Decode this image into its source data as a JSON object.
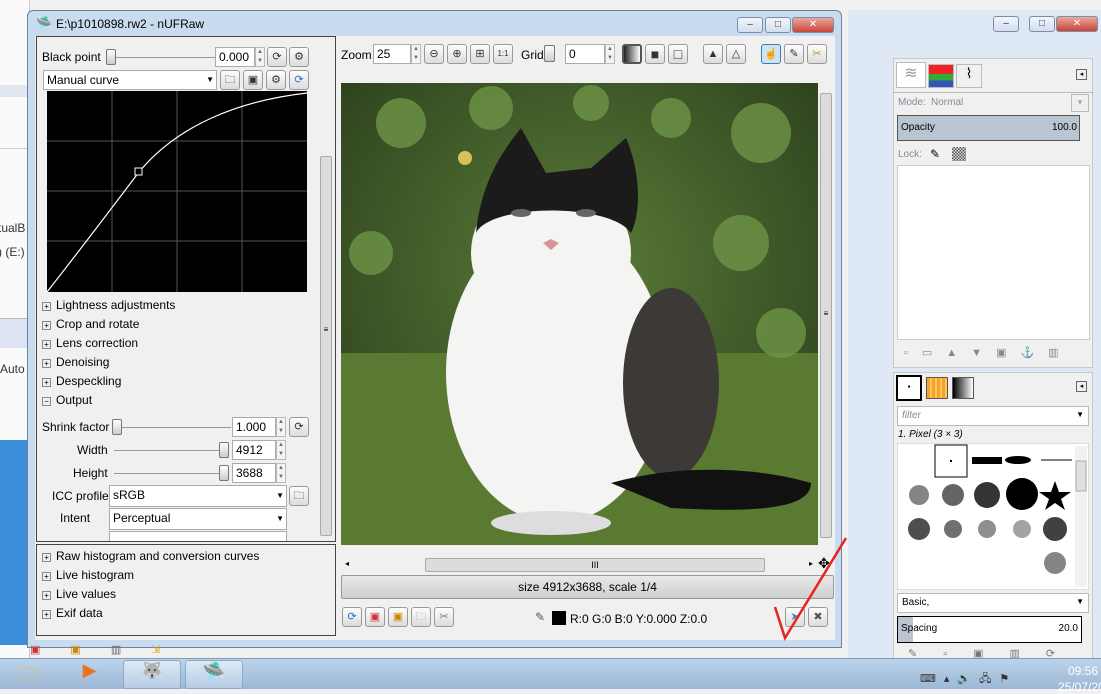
{
  "background": {
    "fragments": [
      "tualB",
      ") (E:)",
      "Auto"
    ]
  },
  "window": {
    "title": "E:\\p1010898.rw2 - nUFRaw",
    "icon": "ufo-icon"
  },
  "left_panel": {
    "black_point": {
      "label": "Black point",
      "value": "0.000"
    },
    "curve_select": "Manual curve",
    "expanders": [
      {
        "label": "Lightness adjustments"
      },
      {
        "label": "Crop and rotate"
      },
      {
        "label": "Lens correction"
      },
      {
        "label": "Denoising"
      },
      {
        "label": "Despeckling"
      },
      {
        "label": "Output",
        "expanded": true
      }
    ],
    "output": {
      "shrink_label": "Shrink factor",
      "shrink_value": "1.000",
      "width_label": "Width",
      "width_value": "4912",
      "height_label": "Height",
      "height_value": "3688",
      "icc_label": "ICC profile",
      "icc_value": "sRGB",
      "intent_label": "Intent",
      "intent_value": "Perceptual"
    },
    "bottom_expanders": [
      {
        "label": "Raw histogram and conversion curves"
      },
      {
        "label": "Live histogram"
      },
      {
        "label": "Live values"
      },
      {
        "label": "Exif data"
      }
    ]
  },
  "toolbar": {
    "zoom_label": "Zoom",
    "zoom_value": "25",
    "grid_label": "Grid",
    "grid_value": "0"
  },
  "status": {
    "size_text": "size 4912x3688, scale 1/4",
    "pixel_values": "R:0 G:0 B:0 Y:0.000 Z:0.0"
  },
  "gimp": {
    "mode_label": "Mode:",
    "mode_value": "Normal",
    "opacity_label": "Opacity",
    "opacity_value": "100.0",
    "lock_label": "Lock:",
    "filter_placeholder": "filter",
    "brush_name": "1. Pixel (3 × 3)",
    "brush_set": "Basic,",
    "spacing_label": "Spacing",
    "spacing_value": "20.0"
  },
  "taskbar": {
    "time": "09:56",
    "date": "25/07/20"
  },
  "colors": {
    "annotation_check": "#e8231f",
    "titlebar": "#c9dbef",
    "close_button": "#c7453a"
  }
}
